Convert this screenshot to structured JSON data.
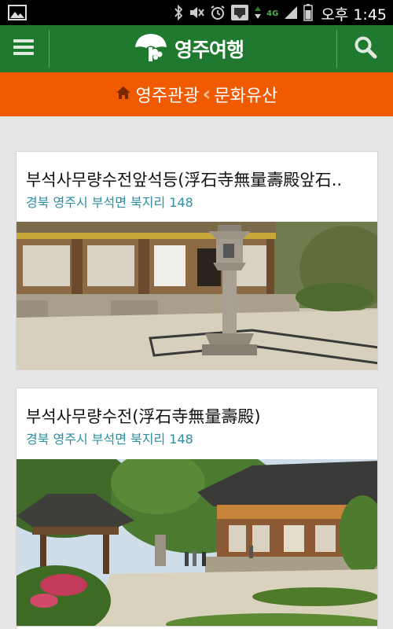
{
  "status_bar": {
    "carrier": "4G",
    "time": "오후 1:45"
  },
  "app": {
    "logo_text": "영주여행",
    "icons": {
      "menu": "hamburger-menu-icon",
      "search": "search-icon",
      "logo": "tree-logo-icon"
    },
    "colors": {
      "appbar": "#1f7a2f",
      "breadcrumb": "#f05a00",
      "address": "#2a8fa3"
    }
  },
  "breadcrumb": {
    "parent": "영주관광",
    "current": "문화유산"
  },
  "items": [
    {
      "title": "부석사무량수전앞석등(浮石寺無量壽殿앞石..",
      "address": "경북 영주시 부석면 북지리 148"
    },
    {
      "title": "부석사무량수전(浮石寺無量壽殿)",
      "address": "경북 영주시 부석면 북지리 148"
    }
  ]
}
